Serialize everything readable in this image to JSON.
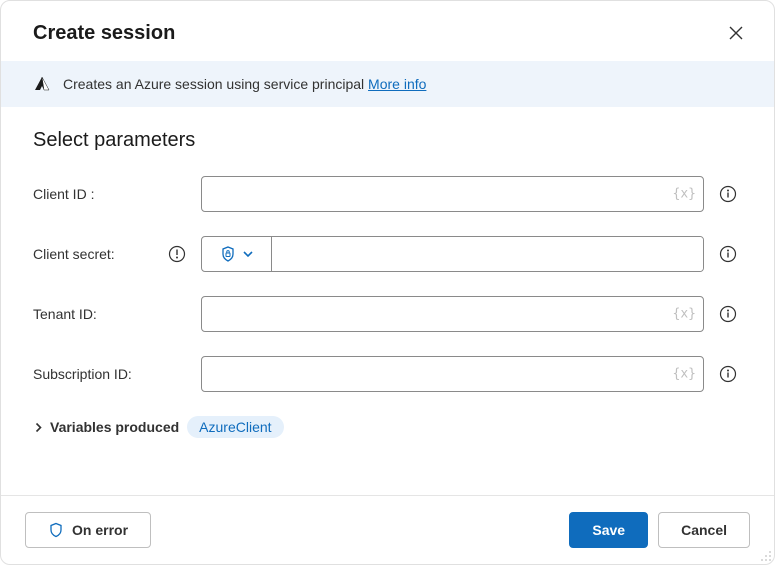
{
  "header": {
    "title": "Create session"
  },
  "banner": {
    "text": "Creates an Azure session using service principal ",
    "link_label": "More info"
  },
  "section": {
    "title": "Select parameters"
  },
  "fields": {
    "client_id": {
      "label": "Client ID :",
      "value": "",
      "var_hint": "{x}"
    },
    "client_secret": {
      "label": "Client secret:",
      "value": ""
    },
    "tenant_id": {
      "label": "Tenant ID:",
      "value": "",
      "var_hint": "{x}"
    },
    "subscription_id": {
      "label": "Subscription ID:",
      "value": "",
      "var_hint": "{x}"
    }
  },
  "variables_produced": {
    "label": "Variables produced",
    "items": [
      "AzureClient"
    ]
  },
  "footer": {
    "on_error": "On error",
    "save": "Save",
    "cancel": "Cancel"
  }
}
